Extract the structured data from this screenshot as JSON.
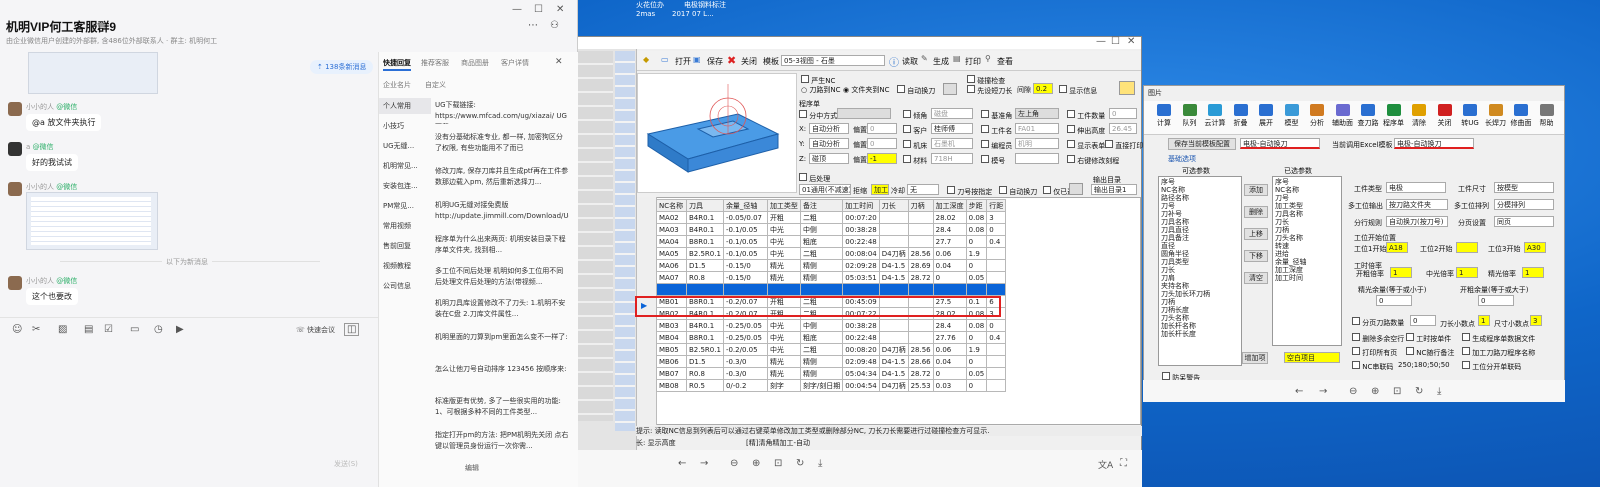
{
  "desktop": {
    "icons": [
      "火花位办",
      "电极钢料标注",
      "2mas",
      "2017 07 L..."
    ]
  },
  "chat": {
    "title": "机明VIP何工客服群9",
    "subtitle": "由企业微信用户创建的外部群, 含486位外部联系人 · 群主: 机明何工",
    "new_msgs": "138条新消息",
    "messages": [
      {
        "user": "小小的人",
        "source": "@微信",
        "text": "@a 放文件夹执行"
      },
      {
        "user": "a",
        "source": "@微信",
        "text": "好的我试试"
      },
      {
        "user": "小小的人",
        "source": "@微信",
        "text": ""
      },
      {
        "user": "小小的人",
        "source": "@微信",
        "text": "这个也要改"
      }
    ],
    "divider": "以下为新消息",
    "toolbar": {
      "meeting": "快速会议"
    },
    "send_hint": "发送(S)",
    "right_tabs": [
      "快捷回复",
      "推荐客服",
      "商品图册",
      "客户详情"
    ],
    "right_tabs2": [
      "企业名片",
      "自定义"
    ],
    "categories": [
      "个人常用",
      "小技巧",
      "UG无缝...",
      "机明常见...",
      "安装包连...",
      "PM常见...",
      "常用视频",
      "售前回复",
      "视频教程",
      "公司信息"
    ],
    "quick_replies": [
      "UG下载链接: https://www.mfcad.com/ug/xiazai/ UG下载...",
      "没有分基础标准专业, 都一样, 加密狗区分了权限, 有些功能用不了而已",
      "修改刀库, 保存刀库并且生成ptf再在工件参数那边载入pm, 然后重新选择刀...",
      "机明UG无缝对接免费版 http://update.jimmill.com/Download/Ug1...",
      "程序单为什么出来两页: 机明安装目录下程序单文件夹, 找到相...",
      "多工位不同后处理 机明如何多工位用不同后处理文件后处理的方法(带视频...",
      "机明刀具库设置修改不了刀头: 1.机明不安装在C盘 2.刀库文件属性...",
      "机明里面的刀算到pm里面怎么变不一样了:",
      "怎么让他刀号自动排序 123456 按顺序来:",
      "标准版更有优势, 多了一些很实用的功能: 1、可根据多种不同的工件类型...",
      "指定打开pm的方法: 把PM机明先关闭 点右键以管理员身份运行一次你需..."
    ],
    "edit_label": "编辑"
  },
  "cad": {
    "toolbar": {
      "open": "打开",
      "save": "保存",
      "close": "关闭",
      "template_label": "模板",
      "template_value": "05-3视图 - 石墨",
      "read": "读取",
      "generate": "生成",
      "print": "打印",
      "view": "查看"
    },
    "options": {
      "strict_nc": "严生NC",
      "tool_to_nc": "刀路到NC",
      "file_to_nc": "文件夹到NC",
      "auto_change": "自动换刀",
      "collision": "碰撞检查",
      "pre_tool": "先设短刀长",
      "gap_label": "间隙",
      "gap_value": "0.2",
      "show_info": "显示信息"
    },
    "program": {
      "heading": "程序单",
      "center_mode": "分中方式",
      "x_label": "X:",
      "x_value": "自动分析",
      "x_offset_label": "偏置",
      "x_offset": "0",
      "y_label": "Y:",
      "y_value": "自动分析",
      "y_offset_label": "偏置",
      "y_offset": "0",
      "z_label": "Z:",
      "z_value": "碰顶",
      "z_offset_label": "偏置",
      "z_offset": "-1",
      "bevel": "倾角",
      "bevel_value": "磁盘",
      "customer": "客户",
      "customer_value": "桂师傅",
      "machine": "机床",
      "machine_value": "石墨机",
      "material": "材料",
      "material_value": "718H",
      "base": "基准角",
      "base_value": "左上角",
      "workpiece": "工件名",
      "workpiece_value": "FA01",
      "programmer": "编程员",
      "programmer_value": "机明",
      "serial": "模号",
      "qty": "工件数量",
      "qty_value": "0",
      "height": "伸出高度",
      "height_value": "26.45",
      "show_table": "显示表单",
      "print_direct": "直接打印",
      "right_edit": "右键修改刻程"
    },
    "post": {
      "heading": "后处理",
      "value": "01通用(不减速)",
      "mode": "加工NC",
      "cool": "冷却",
      "cool_value": "无",
      "tool_sort": "刀号按指定",
      "auto_change": "自动换刀",
      "only_tool": "仅已选",
      "out_label": "输出目录",
      "out_value": "输出目录1"
    },
    "table": {
      "headers": [
        "NC名称",
        "刀具",
        "余量_径轴",
        "加工类型",
        "备注",
        "加工时间",
        "刀长",
        "刀柄",
        "加工深度",
        "步距",
        "行距"
      ],
      "rows": [
        [
          "MA02",
          "B4R0.1",
          "-0.05/0.07",
          "开粗",
          "二粗",
          "00:07:20",
          "",
          "",
          "28.02",
          "0.08",
          "3"
        ],
        [
          "MA03",
          "B4R0.1",
          "-0.1/0.05",
          "中光",
          "中侧",
          "00:38:28",
          "",
          "",
          "28.4",
          "0.08",
          "0"
        ],
        [
          "MA04",
          "B8R0.1",
          "-0.1/0.05",
          "中光",
          "粗底",
          "00:22:48",
          "",
          "",
          "27.7",
          "0",
          "0.4"
        ],
        [
          "MA05",
          "B2.5R0.1",
          "-0.1/0.05",
          "中光",
          "二粗",
          "00:08:04",
          "D4刀柄",
          "28.56",
          "0.06",
          "1.9",
          ""
        ],
        [
          "MA06",
          "D1.5",
          "-0.15/0",
          "精光",
          "精侧",
          "02:09:28",
          "D4-1.5",
          "28.69",
          "0.04",
          "0",
          ""
        ],
        [
          "MA07",
          "R0.8",
          "-0.15/0",
          "精光",
          "精侧",
          "05:03:51",
          "D4-1.5",
          "28.72",
          "0",
          "0.05",
          ""
        ],
        [
          "",
          "",
          "",
          "",
          "",
          "",
          "",
          "",
          "",
          "",
          ""
        ],
        [
          "MB01",
          "B8R0.1",
          "-0.2/0.07",
          "开粗",
          "二粗",
          "00:45:09",
          "",
          "",
          "27.5",
          "0.1",
          "6"
        ],
        [
          "MB02",
          "B4R0.1",
          "-0.2/0.07",
          "开粗",
          "二粗",
          "00:07:22",
          "",
          "",
          "28.02",
          "0.08",
          "3"
        ],
        [
          "MB03",
          "B4R0.1",
          "-0.25/0.05",
          "中光",
          "中侧",
          "00:38:28",
          "",
          "",
          "28.4",
          "0.08",
          "0"
        ],
        [
          "MB04",
          "B8R0.1",
          "-0.25/0.05",
          "中光",
          "粗底",
          "00:22:48",
          "",
          "",
          "27.76",
          "0",
          "0.4"
        ],
        [
          "MB05",
          "B2.5R0.1",
          "-0.2/0.05",
          "中光",
          "二粗",
          "00:08:20",
          "D4刀柄",
          "28.56",
          "0.06",
          "1.9",
          ""
        ],
        [
          "MB06",
          "D1.5",
          "-0.3/0",
          "精光",
          "精侧",
          "02:09:48",
          "D4-1.5",
          "28.66",
          "0.04",
          "0",
          ""
        ],
        [
          "MB07",
          "R0.8",
          "-0.3/0",
          "精光",
          "精侧",
          "05:04:34",
          "D4-1.5",
          "28.72",
          "0",
          "0.05",
          ""
        ],
        [
          "MB08",
          "R0.5",
          "0/-0.2",
          "刻字",
          "刻字/刻日期",
          "00:04:54",
          "D4刀柄",
          "25.53",
          "0.03",
          "0",
          ""
        ]
      ]
    },
    "hint": "提示: 读取NC信息到列表后可以通过右键菜单修改加工类型或删除部分NC, 刀长刀长需要进行过碰撞检查方可显示.",
    "bottom": {
      "left": "长: 显示高度",
      "right": "[精]清角精加工-自动"
    }
  },
  "rwin": {
    "title": "图片",
    "ribbon": [
      "计算",
      "队列",
      "云计算",
      "折叠",
      "展开",
      "模型",
      "分析",
      "辅助面",
      "查刀路",
      "程序单",
      "清除",
      "关闭",
      "转UG",
      "长焊刀",
      "修曲面",
      "帮助"
    ],
    "save_template": "保存当前模板配置",
    "template_value": "电极-自动换刀",
    "excel_label": "当前调用Excel模板",
    "excel_value": "电极-自动换刀",
    "basic_tab": "基础选项",
    "available_label": "可选参数",
    "selected_label": "已选参数",
    "available": [
      "序号",
      "NC名称",
      "路径名称",
      "刀号",
      "刀补号",
      "刀具名称",
      "刀具直径",
      "刀具备注",
      "直径",
      "圆角半径",
      "刀具类型",
      "刀长",
      "刀肩",
      "夹持名称",
      "刀头加长环刀柄",
      "刀柄",
      "刀柄长度",
      "刀头名称",
      "加长杆名称",
      "加长杆长度"
    ],
    "selected": [
      "序号",
      "NC名称",
      "刀号",
      "加工类型",
      "刀具名称",
      "刀长",
      "刀柄",
      "刀头名称",
      "转速",
      "进给",
      "余量_径轴",
      "加工深度",
      "加工时间"
    ],
    "buttons": [
      "添加",
      "删除",
      "上移",
      "下移",
      "清空"
    ],
    "add_item": "增加项",
    "blank_item": "空白项目",
    "anti_warn": "防呆警告",
    "right": {
      "wp_type": "工件类型",
      "wp_type_value": "电极",
      "wp_size": "工件尺寸",
      "wp_size_value": "按模型",
      "multi_out": "多工位输出",
      "multi_out_value": "按刀路文件夹",
      "multi_sort": "多工位排列",
      "multi_sort_value": "分模排列",
      "line_rule": "分行规则",
      "line_rule_value": "自动换刀(按刀号)",
      "page_rule": "分页设置",
      "page_rule_value": "同页",
      "pos_label": "工位开始位置",
      "s1": "工位1开始",
      "s1_value": "A18",
      "s2": "工位2开始",
      "s2_value": "",
      "s3": "工位3开始",
      "s3_value": "A30",
      "ratio": "工时倍率",
      "r1": "开粗倍率",
      "r1_value": "1",
      "r2": "中光倍率",
      "r2_value": "1",
      "r3": "精光倍率",
      "r3_value": "1",
      "ref1": "精光余量(等于或小于)",
      "ref1_value": "0",
      "ref2": "开粗余量(等于或大于)",
      "ref2_value": "0",
      "split_qty": "分页刀路数量",
      "split_qty_value": "0",
      "tool_dec": "刀长小数点",
      "tool_dec_value": "1",
      "size_dec": "尺寸小数点",
      "size_dec_value": "3",
      "del_blank": "删除多余空行",
      "tool_check": "工时按单件",
      "gen_file": "生成程序单数据文件",
      "print_all": "打印所有页",
      "nc_attach": "NC随行备注",
      "ug_attach": "加工刀路刀程序名称",
      "nc_link": "NC串联码",
      "nc_link_value": "250;180;50;50",
      "split_one": "工位分开单联码"
    }
  }
}
